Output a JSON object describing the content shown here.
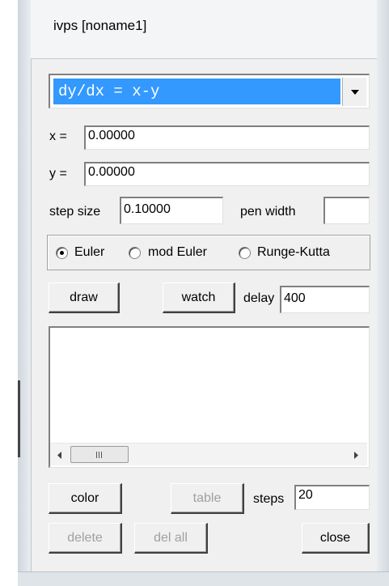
{
  "window": {
    "title": "ivps  [noname1]"
  },
  "equation": {
    "selected": "dy/dx = x-y"
  },
  "fields": {
    "x_label": "x =",
    "x_value": "0.00000",
    "y_label": "y =",
    "y_value": "0.00000",
    "step_size_label": "step size",
    "step_size_value": "0.10000",
    "pen_width_label": "pen width",
    "pen_width_value": ""
  },
  "methods": {
    "selected": "Euler",
    "items": [
      "Euler",
      "mod Euler",
      "Runge-Kutta"
    ]
  },
  "controls": {
    "draw_label": "draw",
    "watch_label": "watch",
    "delay_label": "delay",
    "delay_value": "400",
    "color_label": "color",
    "table_label": "table",
    "steps_label": "steps",
    "steps_value": "20",
    "delete_label": "delete",
    "del_all_label": "del all",
    "close_label": "close"
  },
  "output_list": {
    "items": []
  },
  "icons": {
    "dropdown": "chevron-down-icon",
    "scroll_left": "arrow-left-icon",
    "scroll_right": "arrow-right-icon",
    "thumb_grip": "grip-icon"
  },
  "colors": {
    "selection": "#3399ff",
    "client": "#f0f0f0"
  }
}
